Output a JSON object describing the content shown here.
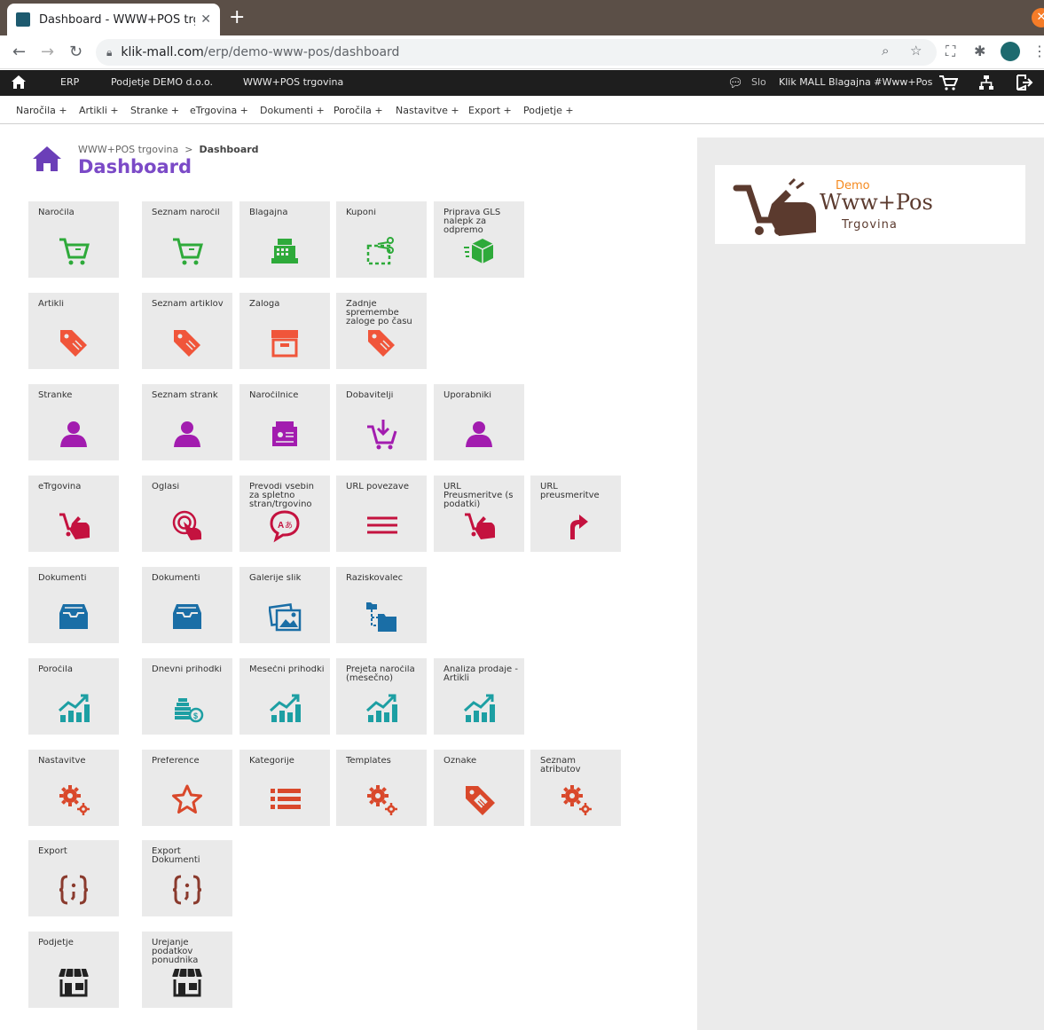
{
  "browser": {
    "tab_title": "Dashboard - WWW+POS trgovina",
    "tab_close": "✕",
    "new_tab": "+",
    "url_host": "klik-mall.com",
    "url_path": "/erp/demo-www-pos/dashboard"
  },
  "appbar": {
    "erp": "ERP",
    "company": "Podjetje DEMO d.o.o.",
    "store": "WWW+POS trgovina",
    "lang": "Slo",
    "register": "Klik MALL Blagajna #Www+Pos"
  },
  "menu": [
    "Naročila +",
    "Artikli +",
    "Stranke +",
    "eTrgovina +",
    "Dokumenti +",
    "Poročila +",
    "Nastavitve +",
    "Export +",
    "Podjetje +"
  ],
  "breadcrumb": {
    "parent": "WWW+POS trgovina",
    "separator": ">",
    "current": "Dashboard"
  },
  "page_title": "Dashboard",
  "colors": {
    "green": "#2eaa3a",
    "orange": "#f0553a",
    "purple": "#a21caf",
    "crimson": "#c4123f",
    "blue": "#1a6ea6",
    "teal": "#1d9fa3",
    "rust": "#d9482b",
    "brown": "#8a3a2d",
    "black": "#222222"
  },
  "tiles": [
    [
      {
        "label": "Naročila",
        "icon": "cart-icon"
      },
      {
        "label": "Seznam naročil",
        "icon": "cart-icon"
      },
      {
        "label": "Blagajna",
        "icon": "cash-register-icon"
      },
      {
        "label": "Kuponi",
        "icon": "coupon-scissors-icon"
      },
      {
        "label": "Priprava GLS nalepk za odpremo",
        "icon": "package-icon"
      }
    ],
    [
      {
        "label": "Artikli",
        "icon": "tag-icon"
      },
      {
        "label": "Seznam artiklov",
        "icon": "tag-icon"
      },
      {
        "label": "Zaloga",
        "icon": "archive-box-icon"
      },
      {
        "label": "Zadnje spremembe zaloge po času",
        "icon": "tag-icon"
      }
    ],
    [
      {
        "label": "Stranke",
        "icon": "user-icon"
      },
      {
        "label": "Seznam strank",
        "icon": "user-icon"
      },
      {
        "label": "Naročilnice",
        "icon": "order-form-icon"
      },
      {
        "label": "Dobavitelji",
        "icon": "supplier-cart-icon"
      },
      {
        "label": "Uporabniki",
        "icon": "user-icon"
      }
    ],
    [
      {
        "label": "eTrgovina",
        "icon": "shop-hand-icon"
      },
      {
        "label": "Oglasi",
        "icon": "target-hand-icon"
      },
      {
        "label": "Prevodi vsebin za spletno stran/trgovino",
        "icon": "translate-icon"
      },
      {
        "label": "URL povezave",
        "icon": "lines-icon"
      },
      {
        "label": "URL Preusmeritve (s podatki)",
        "icon": "shop-hand-icon"
      },
      {
        "label": "URL preusmeritve",
        "icon": "redirect-arrow-icon"
      }
    ],
    [
      {
        "label": "Dokumenti",
        "icon": "inbox-icon"
      },
      {
        "label": "Dokumenti",
        "icon": "inbox-icon"
      },
      {
        "label": "Galerije slik",
        "icon": "image-gallery-icon"
      },
      {
        "label": "Raziskovalec",
        "icon": "folder-tree-icon"
      }
    ],
    [
      {
        "label": "Poročila",
        "icon": "chart-growth-icon"
      },
      {
        "label": "Dnevni prihodki",
        "icon": "coins-icon"
      },
      {
        "label": "Mesečni prihodki",
        "icon": "chart-growth-icon"
      },
      {
        "label": "Prejeta naročila (mesečno)",
        "icon": "chart-growth-icon"
      },
      {
        "label": "Analiza prodaje - Artikli",
        "icon": "chart-growth-icon"
      }
    ],
    [
      {
        "label": "Nastavitve",
        "icon": "gears-icon"
      },
      {
        "label": "Preference",
        "icon": "star-icon"
      },
      {
        "label": "Kategorije",
        "icon": "list-icon"
      },
      {
        "label": "Templates",
        "icon": "gears-icon"
      },
      {
        "label": "Oznake",
        "icon": "label-tag-icon"
      },
      {
        "label": "Seznam atributov",
        "icon": "gears-icon"
      }
    ],
    [
      {
        "label": "Export",
        "icon": "code-braces-icon"
      },
      {
        "label": "Export Dokumenti",
        "icon": "code-braces-icon"
      }
    ],
    [
      {
        "label": "Podjetje",
        "icon": "storefront-icon"
      },
      {
        "label": "Urejanje podatkov ponudnika",
        "icon": "storefront-icon"
      }
    ]
  ],
  "logo": {
    "demo": "Demo",
    "name": "Www+Pos",
    "sub": "Trgovina"
  }
}
